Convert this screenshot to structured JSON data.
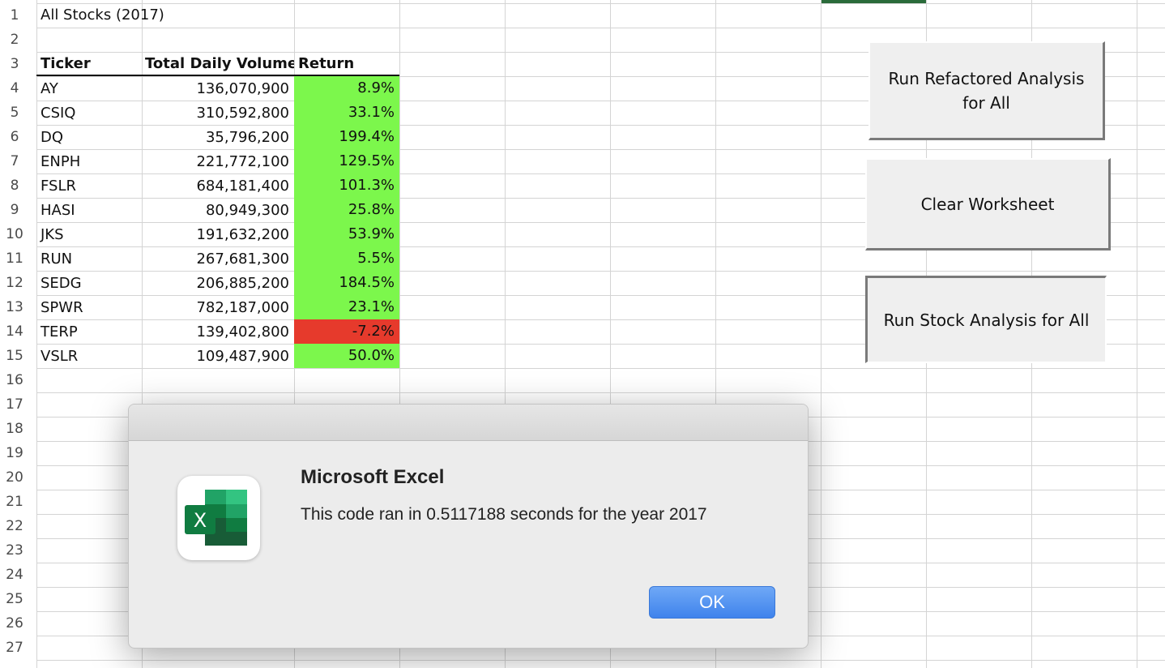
{
  "spreadsheet": {
    "row_numbers": [
      "1",
      "2",
      "3",
      "4",
      "5",
      "6",
      "7",
      "8",
      "9",
      "10",
      "11",
      "12",
      "13",
      "14",
      "15",
      "16",
      "17",
      "18",
      "19",
      "20",
      "21",
      "22",
      "23",
      "24",
      "25",
      "26",
      "27"
    ],
    "title_cell": "All Stocks (2017)",
    "headers": {
      "ticker": "Ticker",
      "volume": "Total Daily Volume",
      "return": "Return"
    },
    "rows": [
      {
        "ticker": "AY",
        "volume": "136,070,900",
        "return": "8.9%",
        "status": "positive"
      },
      {
        "ticker": "CSIQ",
        "volume": "310,592,800",
        "return": "33.1%",
        "status": "positive"
      },
      {
        "ticker": "DQ",
        "volume": "35,796,200",
        "return": "199.4%",
        "status": "positive"
      },
      {
        "ticker": "ENPH",
        "volume": "221,772,100",
        "return": "129.5%",
        "status": "positive"
      },
      {
        "ticker": "FSLR",
        "volume": "684,181,400",
        "return": "101.3%",
        "status": "positive"
      },
      {
        "ticker": "HASI",
        "volume": "80,949,300",
        "return": "25.8%",
        "status": "positive"
      },
      {
        "ticker": "JKS",
        "volume": "191,632,200",
        "return": "53.9%",
        "status": "positive"
      },
      {
        "ticker": "RUN",
        "volume": "267,681,300",
        "return": "5.5%",
        "status": "positive"
      },
      {
        "ticker": "SEDG",
        "volume": "206,885,200",
        "return": "184.5%",
        "status": "positive"
      },
      {
        "ticker": "SPWR",
        "volume": "782,187,000",
        "return": "23.1%",
        "status": "positive"
      },
      {
        "ticker": "TERP",
        "volume": "139,402,800",
        "return": "-7.2%",
        "status": "negative"
      },
      {
        "ticker": "VSLR",
        "volume": "109,487,900",
        "return": "50.0%",
        "status": "positive"
      }
    ]
  },
  "colors": {
    "positive": "#7cf74c",
    "negative": "#e63a2c",
    "ok_button": "#4a8ff0",
    "selected_tab": "#2a6b3a"
  },
  "buttons": {
    "refactored": "Run Refactored Analysis for All",
    "clear": "Clear Worksheet",
    "stock": "Run Stock Analysis for All"
  },
  "dialog": {
    "app_icon": "excel-icon",
    "app_letter": "X",
    "title": "Microsoft Excel",
    "message": "This code ran in 0.5117188 seconds for the year 2017",
    "ok_label": "OK"
  }
}
